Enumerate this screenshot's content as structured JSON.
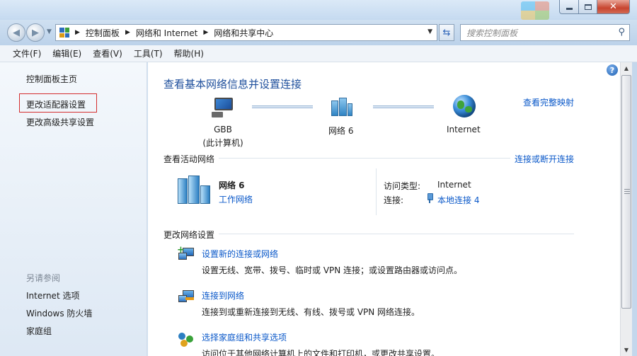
{
  "window": {
    "minimize": "—",
    "close": "✕"
  },
  "nav": {
    "breadcrumbs": [
      "控制面板",
      "网络和 Internet",
      "网络和共享中心"
    ],
    "search_placeholder": "搜索控制面板"
  },
  "menu": [
    "文件(F)",
    "编辑(E)",
    "查看(V)",
    "工具(T)",
    "帮助(H)"
  ],
  "sidebar": {
    "links": [
      "控制面板主页",
      "更改适配器设置",
      "更改高级共享设置"
    ],
    "see_also_heading": "另请参阅",
    "see_also": [
      "Internet 选项",
      "Windows 防火墙",
      "家庭组"
    ]
  },
  "main": {
    "title": "查看基本网络信息并设置连接",
    "view_full_map": "查看完整映射",
    "map": {
      "computer_name": "GBB",
      "computer_sub": "(此计算机)",
      "network": "网络  6",
      "internet": "Internet"
    },
    "active": {
      "label": "查看活动网络",
      "connect_link": "连接或断开连接",
      "network_name": "网络  6",
      "network_type": "工作网络",
      "access_type_label": "访问类型:",
      "access_type_value": "Internet",
      "connections_label": "连接:",
      "connections_value": "本地连接 4"
    },
    "change": {
      "label": "更改网络设置",
      "tasks": [
        {
          "title": "设置新的连接或网络",
          "desc": "设置无线、宽带、拨号、临时或 VPN 连接；或设置路由器或访问点。"
        },
        {
          "title": "连接到网络",
          "desc": "连接到或重新连接到无线、有线、拨号或 VPN 网络连接。"
        },
        {
          "title": "选择家庭组和共享选项",
          "desc": "访问位于其他网络计算机上的文件和打印机，或更改共享设置。"
        }
      ]
    }
  },
  "help": "?"
}
